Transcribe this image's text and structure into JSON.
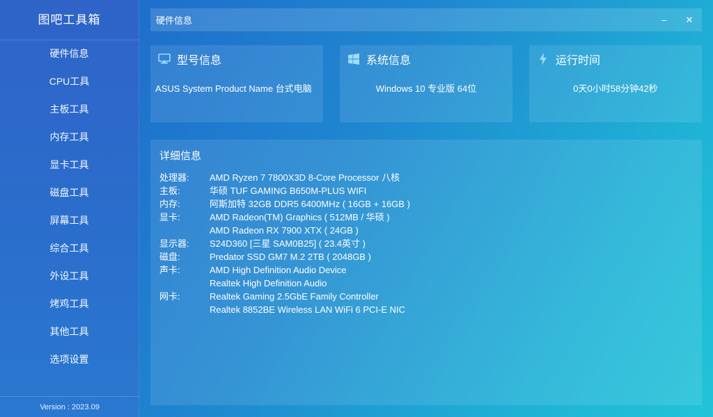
{
  "app": {
    "title": "图吧工具箱",
    "version": "Version : 2023.09"
  },
  "sidebar": {
    "items": [
      {
        "label": "硬件信息"
      },
      {
        "label": "CPU工具"
      },
      {
        "label": "主板工具"
      },
      {
        "label": "内存工具"
      },
      {
        "label": "显卡工具"
      },
      {
        "label": "磁盘工具"
      },
      {
        "label": "屏幕工具"
      },
      {
        "label": "综合工具"
      },
      {
        "label": "外设工具"
      },
      {
        "label": "烤鸡工具"
      },
      {
        "label": "其他工具"
      },
      {
        "label": "选项设置"
      }
    ]
  },
  "header": {
    "title": "硬件信息",
    "minimize": "–",
    "close": "✕"
  },
  "cards": {
    "model": {
      "title": "型号信息",
      "value": "ASUS System Product Name 台式电脑",
      "icon": "monitor-icon"
    },
    "system": {
      "title": "系统信息",
      "value": "Windows 10 专业版 64位",
      "icon": "windows-icon"
    },
    "uptime": {
      "title": "运行时间",
      "value": "0天0小时58分钟42秒",
      "icon": "lightning-icon"
    }
  },
  "detail": {
    "title": "详细信息",
    "rows": [
      {
        "label": "处理器:",
        "value": "AMD Ryzen 7 7800X3D 8-Core Processor 八核"
      },
      {
        "label": "主板:",
        "value": "华硕 TUF GAMING B650M-PLUS WIFI"
      },
      {
        "label": "内存:",
        "value": "阿斯加特 32GB DDR5 6400MHz ( 16GB + 16GB )"
      },
      {
        "label": "显卡:",
        "value": "AMD Radeon(TM) Graphics ( 512MB / 华硕 )"
      },
      {
        "label": "",
        "value": "AMD Radeon RX 7900 XTX ( 24GB )"
      },
      {
        "label": "显示器:",
        "value": "S24D360 [三星 SAM0B25] ( 23.4英寸 )"
      },
      {
        "label": "磁盘:",
        "value": "Predator SSD GM7 M.2 2TB ( 2048GB )"
      },
      {
        "label": "声卡:",
        "value": "AMD High Definition Audio Device"
      },
      {
        "label": "",
        "value": "Realtek High Definition Audio"
      },
      {
        "label": "网卡:",
        "value": "Realtek Gaming 2.5GbE Family Controller"
      },
      {
        "label": "",
        "value": "Realtek 8852BE Wireless LAN WiFi 6 PCI-E NIC"
      }
    ]
  },
  "colors": {
    "accent": "#2f63c8",
    "icon": "#9fdcff"
  }
}
